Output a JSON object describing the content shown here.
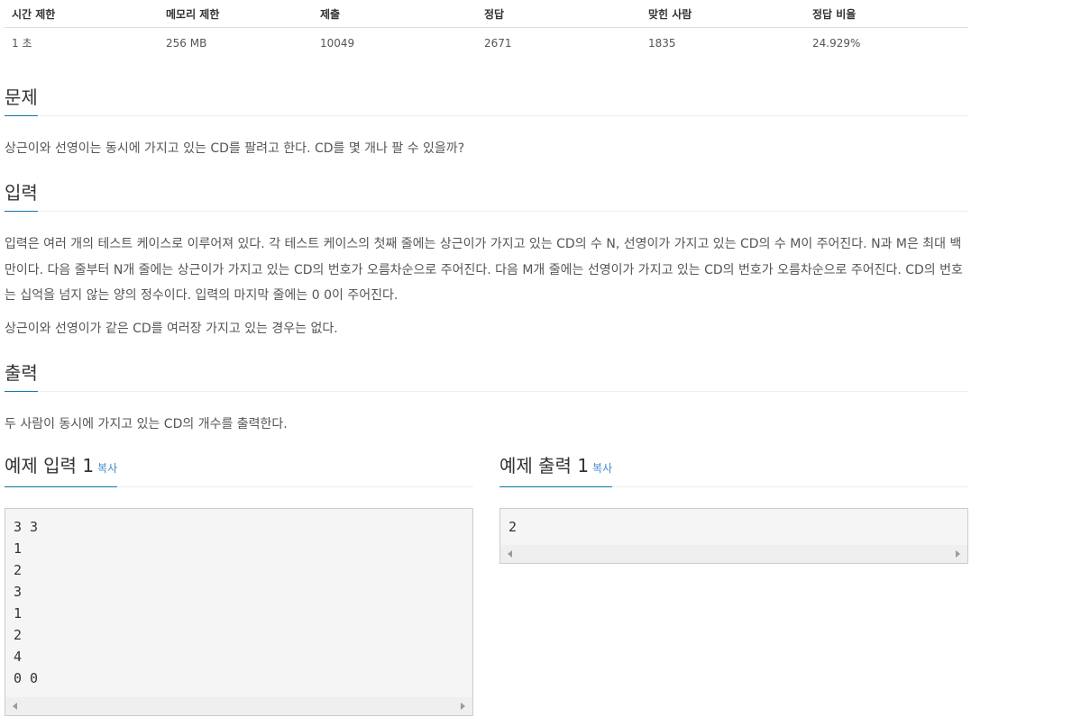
{
  "info_table": {
    "headers": [
      "시간 제한",
      "메모리 제한",
      "제출",
      "정답",
      "맞힌 사람",
      "정답 비율"
    ],
    "values": [
      "1 초",
      "256 MB",
      "10049",
      "2671",
      "1835",
      "24.929%"
    ]
  },
  "problem": {
    "title": "문제",
    "description": "상근이와 선영이는 동시에 가지고 있는 CD를 팔려고 한다. CD를 몇 개나 팔 수 있을까?"
  },
  "input": {
    "title": "입력",
    "paragraph1": "입력은 여러 개의 테스트 케이스로 이루어져 있다. 각 테스트 케이스의 첫째 줄에는 상근이가 가지고 있는 CD의 수 N, 선영이가 가지고 있는 CD의 수 M이 주어진다. N과 M은 최대 백만이다. 다음 줄부터 N개 줄에는 상근이가 가지고 있는 CD의 번호가 오름차순으로 주어진다. 다음 M개 줄에는 선영이가 가지고 있는 CD의 번호가 오름차순으로 주어진다. CD의 번호는 십억을 넘지 않는 양의 정수이다. 입력의 마지막 줄에는 0 0이 주어진다.",
    "paragraph2": "상근이와 선영이가 같은 CD를 여러장 가지고 있는 경우는 없다."
  },
  "output": {
    "title": "출력",
    "description": "두 사람이 동시에 가지고 있는 CD의 개수를 출력한다."
  },
  "sample_input": {
    "title": "예제 입력 1",
    "copy_label": "복사",
    "content": "3 3\n1\n2\n3\n1\n2\n4\n0 0"
  },
  "sample_output": {
    "title": "예제 출력 1",
    "copy_label": "복사",
    "content": "2"
  },
  "colors": {
    "accent": "#0e76a8",
    "link": "#428bca",
    "sample_bg": "#f5f5f5"
  }
}
